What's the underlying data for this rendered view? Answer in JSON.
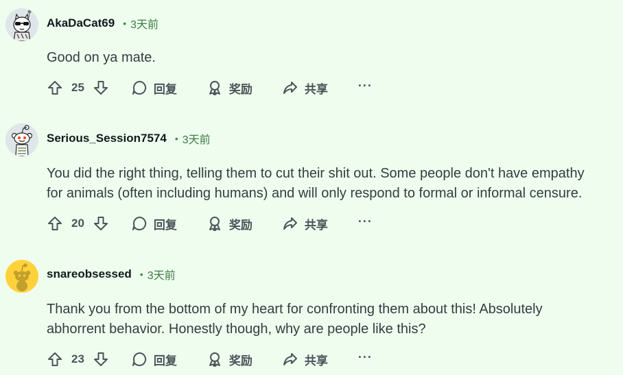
{
  "labels": {
    "reply": "回复",
    "award": "奖励",
    "share": "共享",
    "more": "···"
  },
  "comments": [
    {
      "username": "AkaDaCat69",
      "time": "3天前",
      "lines": [
        "Good on ya mate."
      ],
      "score": "25",
      "avatar": "cat-avatar-with-sunglasses"
    },
    {
      "username": "Serious_Session7574",
      "time": "3天前",
      "lines": [
        "You did the right thing, telling them to cut their shit out. Some people don't have empathy",
        "for animals (often including humans) and will only respond to formal or informal censure."
      ],
      "score": "20",
      "avatar": "snoo-avatar"
    },
    {
      "username": "snareobsessed",
      "time": "3天前",
      "lines": [
        "Thank you from the bottom of my heart for confronting them about this! Absolutely",
        "abhorrent behavior. Honestly though, why are people like this?"
      ],
      "score": "23",
      "avatar": "yellow-snoo-avatar"
    }
  ],
  "colors": {
    "background": "#eefdee",
    "time_green": "#3d7a45",
    "icon_gray": "#4a5458"
  }
}
